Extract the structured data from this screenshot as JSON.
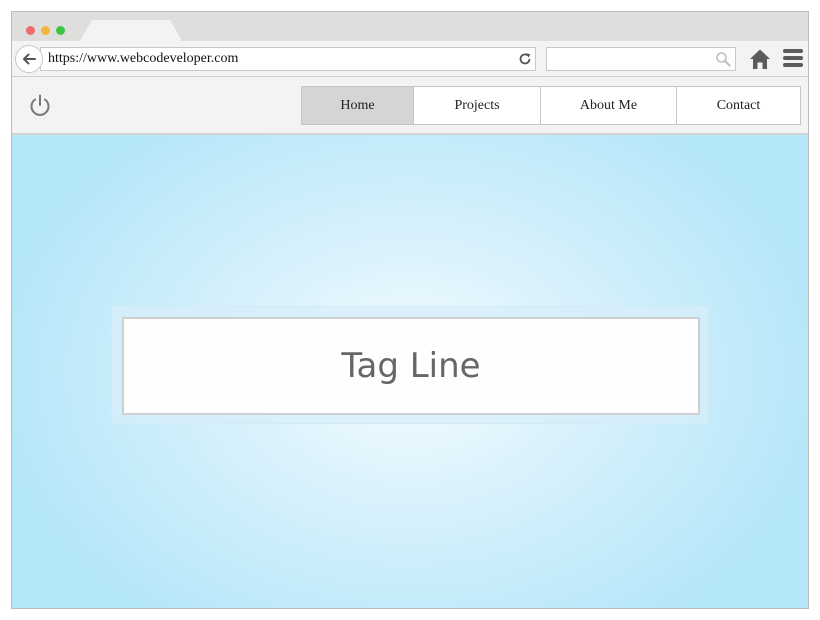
{
  "browser": {
    "url": "https://www.webcodeveloper.com",
    "search_value": "",
    "icons": {
      "back": "arrow-left-icon",
      "reload": "reload-icon",
      "search": "search-icon",
      "home": "home-icon",
      "menu": "hamburger-menu-icon"
    },
    "window_dots": [
      "#f06d6f",
      "#f3b53e",
      "#3fc445"
    ]
  },
  "site": {
    "logo_icon": "power-icon",
    "nav": {
      "items": [
        {
          "label": "Home",
          "active": true
        },
        {
          "label": "Projects",
          "active": false
        },
        {
          "label": "About Me",
          "active": false
        },
        {
          "label": "Contact",
          "active": false
        }
      ]
    },
    "hero": {
      "tagline": "Tag Line"
    }
  },
  "colors": {
    "hero_background": "#b4e6f9",
    "nav_active": "#d5d5d5",
    "chrome": "#f3f3f3"
  }
}
